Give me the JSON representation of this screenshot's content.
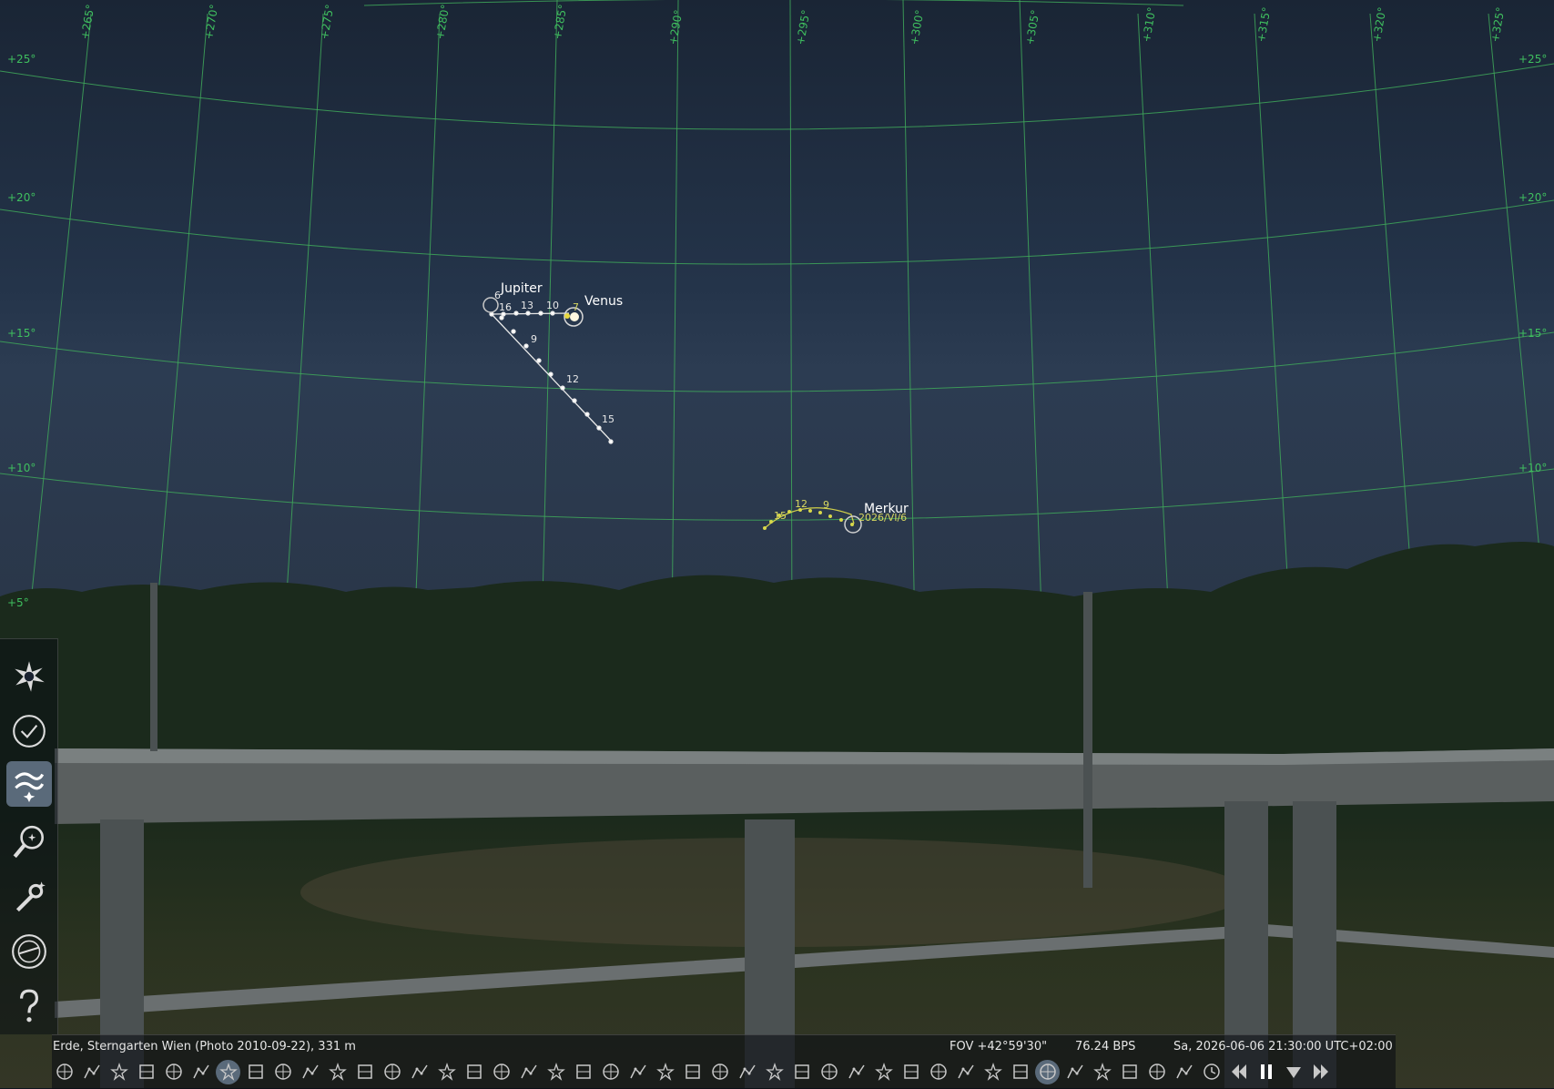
{
  "planets": [
    {
      "name": "Jupiter",
      "trail_labels": [
        "6",
        "16",
        "13",
        "10",
        "9",
        "12",
        "15"
      ]
    },
    {
      "name": "Venus",
      "trail_labels": [
        "7"
      ]
    },
    {
      "name": "Merkur",
      "trail_labels": [
        "12",
        "9",
        "15",
        "2026/VI/6"
      ]
    }
  ],
  "grid_labels": {
    "azimuth": [
      "+265°",
      "+270°",
      "+275°",
      "+280°",
      "+285°",
      "+290°",
      "+295°",
      "+300°",
      "+305°",
      "+310°",
      "+315°",
      "+320°",
      "+325°"
    ],
    "altitude": [
      "+25°",
      "+20°",
      "+15°",
      "+10°",
      "+5°"
    ]
  },
  "status": {
    "location": "Erde, Sterngarten Wien (Photo 2010-09-22), 331 m",
    "fov": "FOV +42°59'30\"",
    "fps": "76.24 BPS",
    "datetime": "Sa, 2026-06-06 21:30:00 UTC+02:00"
  },
  "left_toolbar": [
    {
      "name": "sky-and-viewing-options-icon",
      "active": false
    },
    {
      "name": "date-time-icon",
      "active": false
    },
    {
      "name": "sky-culture-icon",
      "active": true
    },
    {
      "name": "search-icon",
      "active": false
    },
    {
      "name": "configuration-icon",
      "active": false
    },
    {
      "name": "astronomical-calculations-icon",
      "active": false
    },
    {
      "name": "help-icon",
      "active": false
    }
  ],
  "bottom_toolbar_icons": [
    "constellation-lines-icon",
    "constellation-labels-icon",
    "constellation-art-icon",
    "constellation-boundaries-icon",
    "asterism-lines-icon",
    "equatorial-grid-icon",
    "azimuthal-grid-icon",
    "ecliptic-grid-icon",
    "ground-icon",
    "atmosphere-icon",
    "deep-sky-objects-icon",
    "planet-labels-icon",
    "exoplanets-icon",
    "dss-icon",
    "hips-icon",
    "satellites-icon",
    "ocular-icon",
    "telescope-frame-icon",
    "flip-horizontal-icon",
    "flip-vertical-icon",
    "bookmark-icon",
    "angle-measure-icon",
    "archaeo-lines-icon",
    "compass-marks-icon",
    "pulsars-icon",
    "planets-hints-icon",
    "grid-lines-icon",
    "meteor-showers-icon",
    "search-tool-icon",
    "observatory-icon",
    "solar-system-icon",
    "location-icon",
    "equatorial-mount-icon",
    "satellites-hints-icon",
    "comets-icon",
    "asteroids-icon",
    "presenter-icon",
    "measure-icon",
    "observer-icon",
    "eye-icon",
    "flag-icon",
    "antenna-icon",
    "clock-icon",
    "rewind-icon",
    "pause-icon",
    "night-mode-icon",
    "fast-forward-icon"
  ]
}
